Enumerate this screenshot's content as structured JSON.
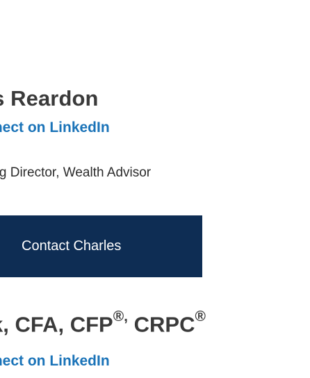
{
  "advisor_1": {
    "name": "Charles Reardon",
    "linkedin_label": "Connect on LinkedIn",
    "title": "Managing Director, Wealth Advisor",
    "contact_label": "Contact Charles"
  },
  "advisor_2": {
    "name_partial": "k, CFA, CFP",
    "reg_mark_1": "®,",
    "name_rest": " CRPC",
    "reg_mark_2": "®",
    "linkedin_label": "Connect on LinkedIn"
  }
}
